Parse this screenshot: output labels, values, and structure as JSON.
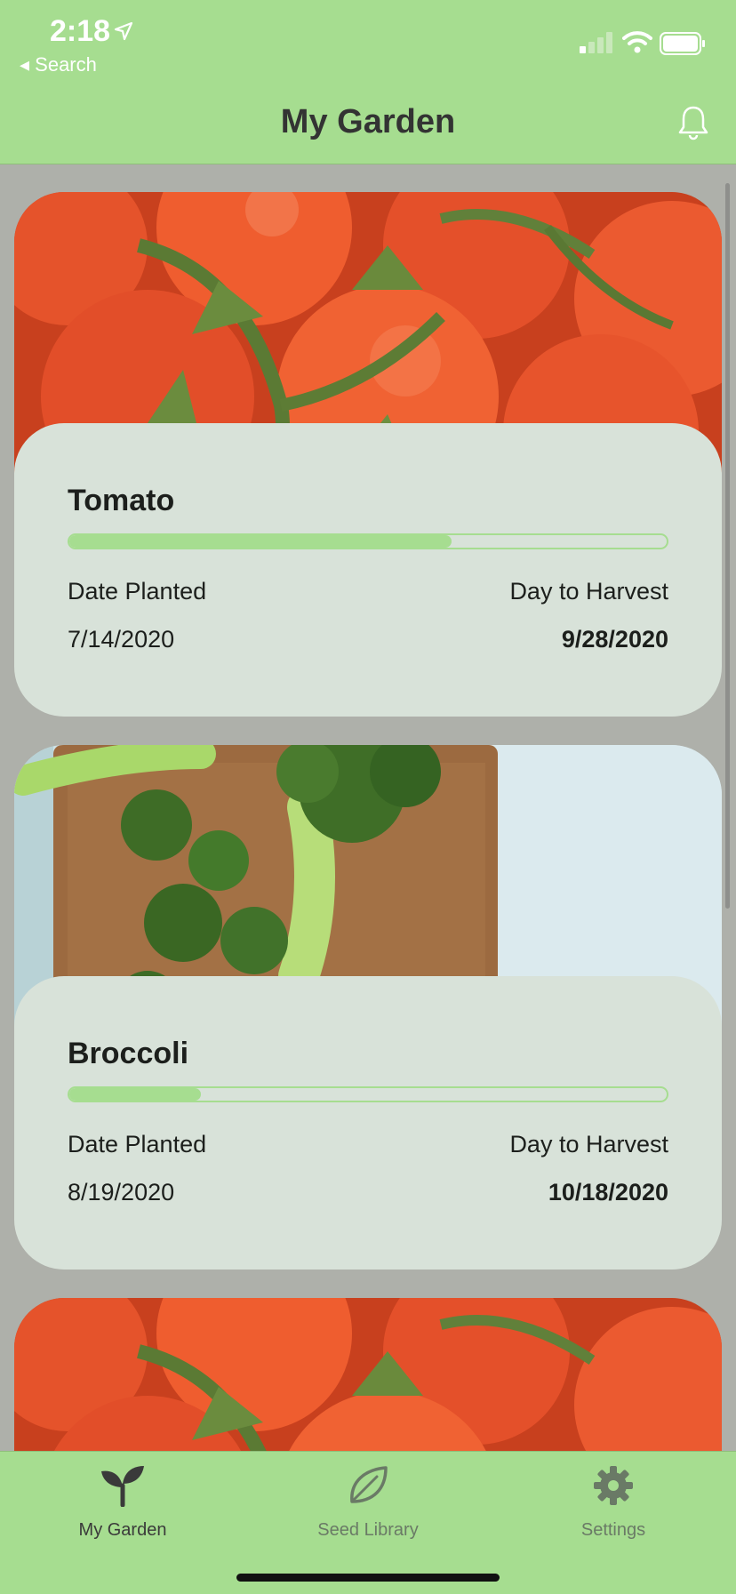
{
  "status": {
    "time": "2:18",
    "back": "◂ Search"
  },
  "header": {
    "title": "My Garden"
  },
  "labels": {
    "planted": "Date Planted",
    "harvest": "Day to Harvest"
  },
  "cards": [
    {
      "name": "Tomato",
      "progress": 0.64,
      "planted": "7/14/2020",
      "harvest": "9/28/2020",
      "image": "tomatoes"
    },
    {
      "name": "Broccoli",
      "progress": 0.22,
      "planted": "8/19/2020",
      "harvest": "10/18/2020",
      "image": "broccoli"
    }
  ],
  "tabs": [
    {
      "label": "My Garden",
      "icon": "sprout-icon",
      "active": true
    },
    {
      "label": "Seed Library",
      "icon": "leaf-icon",
      "active": false
    },
    {
      "label": "Settings",
      "icon": "gear-icon",
      "active": false
    }
  ],
  "colors": {
    "accent": "#a6dd90",
    "card": "#d8e2d9",
    "background": "#aeb0aa"
  }
}
